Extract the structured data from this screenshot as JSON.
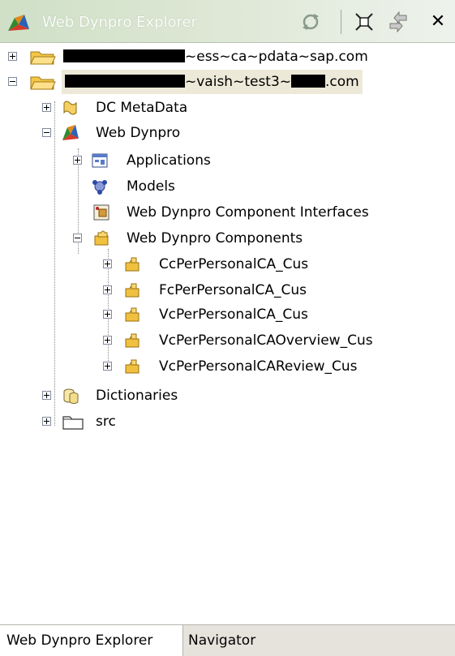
{
  "title": "Web Dynpro Explorer",
  "toolbar": {
    "sync_icon": "sync-icon",
    "collapse_icon": "collapse-all-icon",
    "link_icon": "link-with-editor-icon",
    "close_icon": "close-icon",
    "close_glyph": "✕"
  },
  "tree": {
    "project1": {
      "label_suffix": "~ess~ca~pdata~sap.com"
    },
    "project2": {
      "label_suffix": "~vaish~test3~",
      "label_end": ".com"
    },
    "dc_metadata": "DC MetaData",
    "web_dynpro": "Web Dynpro",
    "applications": "Applications",
    "models": "Models",
    "component_interfaces": "Web Dynpro Component Interfaces",
    "components": "Web Dynpro Components",
    "component_items": [
      "CcPerPersonalCA_Cus",
      "FcPerPersonalCA_Cus",
      "VcPerPersonalCA_Cus",
      "VcPerPersonalCAOverview_Cus",
      "VcPerPersonalCAReview_Cus"
    ],
    "dictionaries": "Dictionaries",
    "src": "src"
  },
  "tabs": [
    "Web Dynpro Explorer",
    "Navigator"
  ],
  "colors": {
    "titlebar_start": "#cfe0c7",
    "selected_row": "#ece9d8",
    "folder_yellow": "#f3c64a",
    "component_yellow": "#f0c040"
  }
}
